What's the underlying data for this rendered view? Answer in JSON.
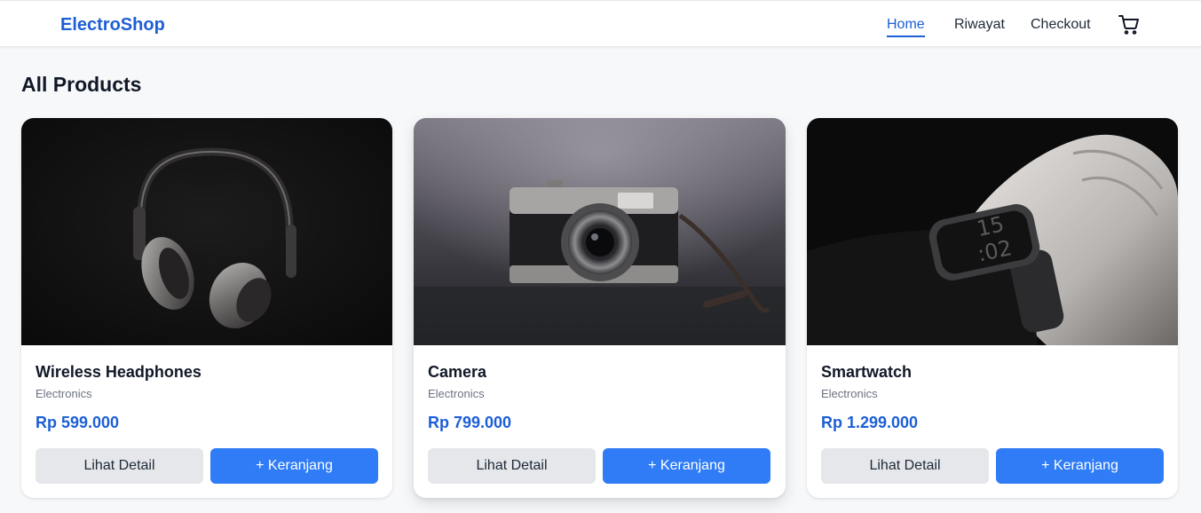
{
  "brand": "ElectroShop",
  "nav": {
    "home": "Home",
    "riwayat": "Riwayat",
    "checkout": "Checkout",
    "cart_icon": "shopping-cart-icon"
  },
  "page_title": "All Products",
  "products": [
    {
      "name": "Wireless Headphones",
      "category": "Electronics",
      "price": "Rp 599.000",
      "detail_label": "Lihat Detail",
      "cart_label": "+ Keranjang"
    },
    {
      "name": "Camera",
      "category": "Electronics",
      "price": "Rp 799.000",
      "detail_label": "Lihat Detail",
      "cart_label": "+ Keranjang"
    },
    {
      "name": "Smartwatch",
      "category": "Electronics",
      "price": "Rp 1.299.000",
      "detail_label": "Lihat Detail",
      "cart_label": "+ Keranjang"
    }
  ],
  "colors": {
    "accent": "#1d5fd6",
    "button_primary": "#2f7cf6",
    "button_secondary": "#e5e7eb",
    "background": "#f7f8fa"
  }
}
